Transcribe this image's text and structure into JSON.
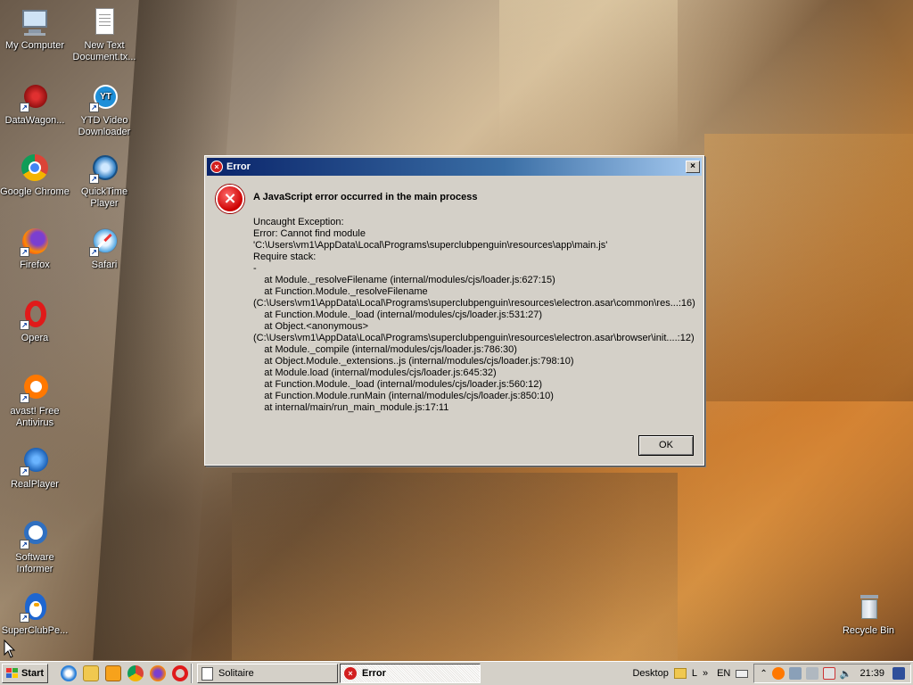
{
  "desktop": {
    "icons": [
      {
        "label": "My Computer",
        "icon": "computer-icon"
      },
      {
        "label": "New Text\nDocument.tx...",
        "icon": "text-document-icon"
      },
      {
        "label": "DataWagon...",
        "icon": "datawagon-icon"
      },
      {
        "label": "YTD Video\nDownloader",
        "icon": "ytd-downloader-icon"
      },
      {
        "label": "Google Chrome",
        "icon": "chrome-icon"
      },
      {
        "label": "QuickTime\nPlayer",
        "icon": "quicktime-icon"
      },
      {
        "label": "Firefox",
        "icon": "firefox-icon"
      },
      {
        "label": "Safari",
        "icon": "safari-icon"
      },
      {
        "label": "Opera",
        "icon": "opera-icon"
      },
      {
        "label": "avast! Free\nAntivirus",
        "icon": "avast-icon"
      },
      {
        "label": "RealPlayer",
        "icon": "realplayer-icon"
      },
      {
        "label": "Software\nInformer",
        "icon": "software-informer-icon"
      },
      {
        "label": "SuperClubPe...",
        "icon": "superclubpenguin-icon"
      },
      {
        "label": "Recycle Bin",
        "icon": "recycle-bin-icon"
      }
    ]
  },
  "dialog": {
    "title": "Error",
    "heading": "A JavaScript error occurred in the main process",
    "body_lines": [
      "Uncaught Exception:",
      "Error: Cannot find module",
      "'C:\\Users\\vm1\\AppData\\Local\\Programs\\superclubpenguin\\resources\\app\\main.js'",
      "Require stack:",
      "-",
      "    at Module._resolveFilename (internal/modules/cjs/loader.js:627:15)",
      "    at Function.Module._resolveFilename",
      "(C:\\Users\\vm1\\AppData\\Local\\Programs\\superclubpenguin\\resources\\electron.asar\\common\\res...:16)",
      "    at Function.Module._load (internal/modules/cjs/loader.js:531:27)",
      "    at Object.<anonymous>",
      "(C:\\Users\\vm1\\AppData\\Local\\Programs\\superclubpenguin\\resources\\electron.asar\\browser\\init....:12)",
      "    at Module._compile (internal/modules/cjs/loader.js:786:30)",
      "    at Object.Module._extensions..js (internal/modules/cjs/loader.js:798:10)",
      "    at Module.load (internal/modules/cjs/loader.js:645:32)",
      "    at Function.Module._load (internal/modules/cjs/loader.js:560:12)",
      "    at Function.Module.runMain (internal/modules/cjs/loader.js:850:10)",
      "    at internal/main/run_main_module.js:17:11"
    ],
    "ok_label": "OK",
    "close_glyph": "×"
  },
  "taskbar": {
    "start_label": "Start",
    "tasks": [
      {
        "label": "Solitaire",
        "active": false
      },
      {
        "label": "Error",
        "active": true
      }
    ],
    "desktop_label": "Desktop",
    "folder_label": "L",
    "language": "EN",
    "clock": "21:39"
  },
  "colors": {
    "title_start": "#0a246a",
    "title_end": "#a6caf0",
    "error_red": "#cc0000",
    "taskbar": "#d4d0c8"
  }
}
